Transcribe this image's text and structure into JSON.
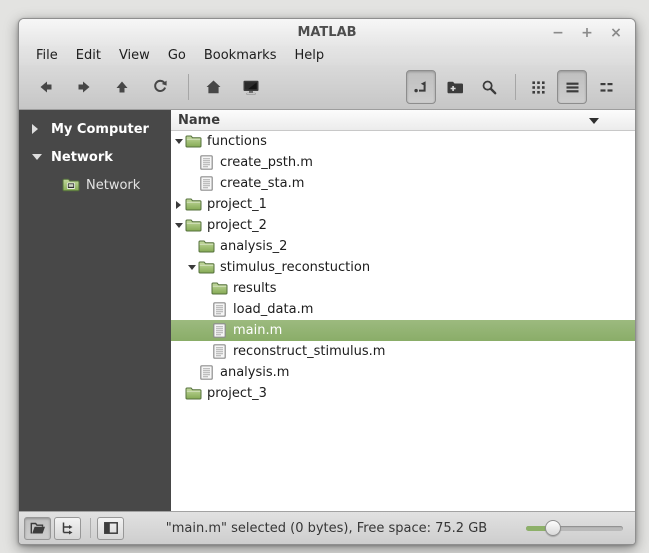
{
  "window": {
    "title": "MATLAB",
    "controls": {
      "minimize": "−",
      "maximize": "+",
      "close": "×"
    }
  },
  "menubar": {
    "items": [
      "File",
      "Edit",
      "View",
      "Go",
      "Bookmarks",
      "Help"
    ]
  },
  "toolbar": {
    "left_buttons": [
      "back",
      "forward",
      "up",
      "refresh",
      "home",
      "computer"
    ],
    "right_buttons": [
      {
        "icon": "toggle-location-entry",
        "active": true
      },
      {
        "icon": "new-folder",
        "active": false
      },
      {
        "icon": "search",
        "active": false
      },
      {
        "icon": "icon-view",
        "active": false
      },
      {
        "icon": "list-view",
        "active": true
      },
      {
        "icon": "compact-view",
        "active": false
      }
    ]
  },
  "sidebar": {
    "rows": [
      {
        "label": "My Computer",
        "type": "header",
        "expander": "closed"
      },
      {
        "label": "Network",
        "type": "header",
        "expander": "open"
      },
      {
        "label": "Network",
        "type": "child",
        "expander": "none",
        "icon": "network-folder"
      }
    ]
  },
  "files": {
    "column_header": "Name",
    "rows": [
      {
        "name": "functions",
        "type": "folder",
        "depth": 0,
        "expander": "open"
      },
      {
        "name": "create_psth.m",
        "type": "file",
        "depth": 1,
        "expander": "none"
      },
      {
        "name": "create_sta.m",
        "type": "file",
        "depth": 1,
        "expander": "none"
      },
      {
        "name": "project_1",
        "type": "folder",
        "depth": 0,
        "expander": "closed"
      },
      {
        "name": "project_2",
        "type": "folder",
        "depth": 0,
        "expander": "open"
      },
      {
        "name": "analysis_2",
        "type": "folder",
        "depth": 1,
        "expander": "none"
      },
      {
        "name": "stimulus_reconstuction",
        "type": "folder",
        "depth": 1,
        "expander": "open"
      },
      {
        "name": "results",
        "type": "folder",
        "depth": 2,
        "expander": "none"
      },
      {
        "name": "load_data.m",
        "type": "file",
        "depth": 2,
        "expander": "none"
      },
      {
        "name": "main.m",
        "type": "file",
        "depth": 2,
        "expander": "none",
        "selected": true
      },
      {
        "name": "reconstruct_stimulus.m",
        "type": "file",
        "depth": 2,
        "expander": "none"
      },
      {
        "name": "analysis.m",
        "type": "file",
        "depth": 1,
        "expander": "none"
      },
      {
        "name": "project_3",
        "type": "folder",
        "depth": 0,
        "expander": "none"
      }
    ]
  },
  "statusbar": {
    "buttons": [
      "show-places",
      "show-treeview",
      "hide-sidebar"
    ],
    "text": "\"main.m\" selected (0 bytes), Free space: 75.2 GB",
    "zoom_percent": 23
  },
  "colors": {
    "selection_green": "#8fb471",
    "sidebar_bg": "#484848",
    "folder_green": "#8cae5c",
    "chrome_gray": "#d2d2d2"
  }
}
